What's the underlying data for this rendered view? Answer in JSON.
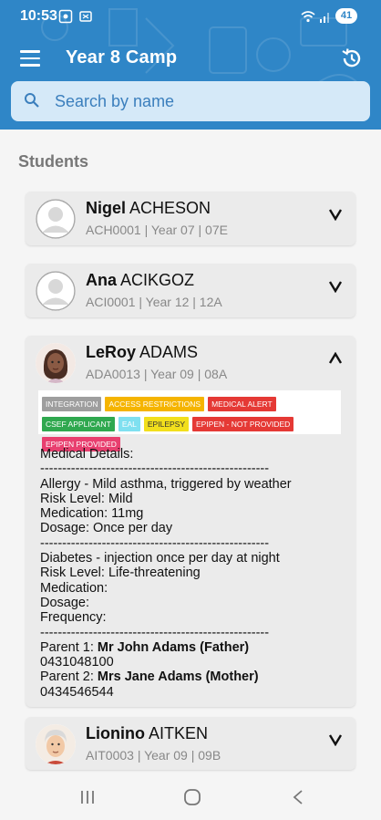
{
  "status_bar": {
    "time": "10:53",
    "battery": "41"
  },
  "header": {
    "title": "Year 8 Camp"
  },
  "search": {
    "placeholder": "Search by name"
  },
  "students_heading": "Students",
  "students": [
    {
      "first": "Nigel",
      "last": "ACHESON",
      "sub": "ACH0001 | Year 07 | 07E",
      "expanded": false
    },
    {
      "first": "Ana",
      "last": "ACIKGOZ",
      "sub": "ACI0001 | Year 12 | 12A",
      "expanded": false
    },
    {
      "first": "LeRoy",
      "last": "ADAMS",
      "sub": "ADA0013 | Year 09 | 08A",
      "expanded": true
    },
    {
      "first": "Lionino",
      "last": "AITKEN",
      "sub": "AIT0003 | Year 09 | 09B",
      "expanded": false
    }
  ],
  "tags": [
    {
      "label": "INTEGRATION",
      "color": "#9e9e9e"
    },
    {
      "label": "ACCESS RESTRICTIONS",
      "color": "#f5b400"
    },
    {
      "label": "MEDICAL ALERT",
      "color": "#e53935"
    },
    {
      "label": "CSEF APPLICANT",
      "color": "#2fa84f"
    },
    {
      "label": "EAL",
      "color": "#7fe0f0"
    },
    {
      "label": "EPILEPSY",
      "color": "#f2df1c"
    },
    {
      "label": "EPIPEN - NOT PROVIDED",
      "color": "#e53935"
    },
    {
      "label": "EPIPEN PROVIDED",
      "color": "#e83f6f"
    }
  ],
  "medical": {
    "heading": "Medical Details:",
    "divider": "----------------------------------------------------",
    "allergy": "Allergy - Mild asthma, triggered by weather",
    "allergy_risk": "Risk Level: Mild",
    "allergy_medication": "Medication: 11mg",
    "allergy_dosage": "Dosage: Once per day",
    "diabetes": "Diabetes - injection once per day at night",
    "diabetes_risk": "Risk Level: Life-threatening",
    "diabetes_medication": "Medication:",
    "diabetes_dosage": "Dosage:",
    "diabetes_frequency": "Frequency:",
    "parent1_label": "Parent 1:",
    "parent1_name": "Mr John Adams (Father)",
    "parent1_phone": "0431048100",
    "parent2_label": "Parent 2:",
    "parent2_name": "Mrs Jane Adams (Mother)",
    "parent2_phone": "0434546544"
  },
  "icons": {
    "menu": "hamburger-menu-icon",
    "history": "history-icon",
    "search": "search-icon",
    "expand": "chevron-down-icon",
    "collapse": "chevron-up-icon",
    "nav_recents": "recents-icon",
    "nav_home": "home-icon",
    "nav_back": "back-icon"
  },
  "colors": {
    "primary": "#2f86c7",
    "search_bg": "#d5e9f8",
    "card_bg": "#ebebeb"
  }
}
